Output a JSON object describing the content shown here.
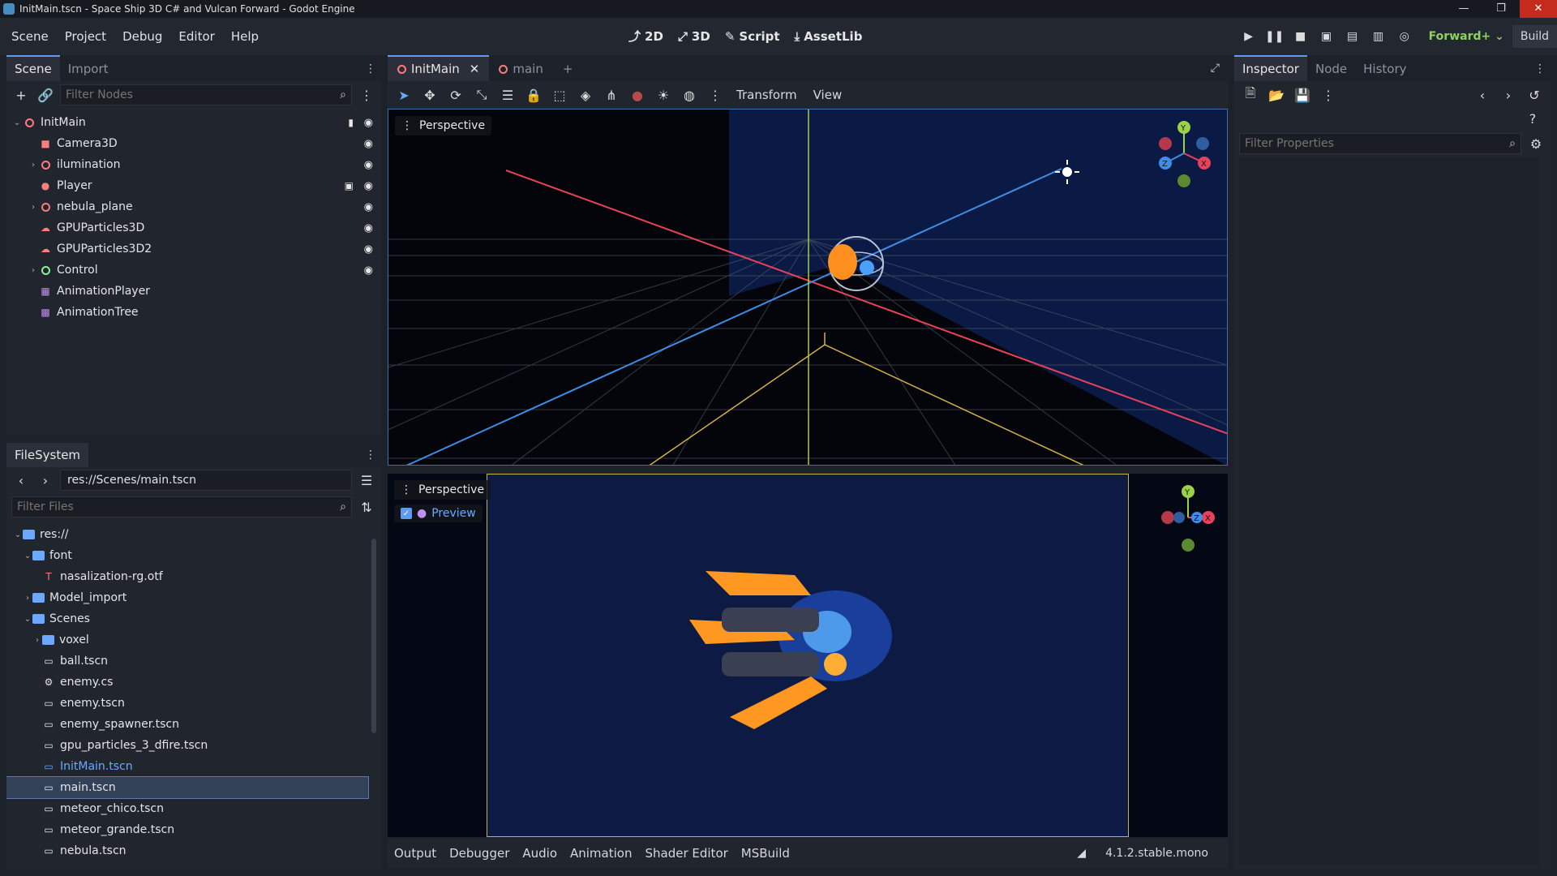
{
  "window": {
    "title": "InitMain.tscn - Space Ship 3D C# and Vulcan Forward - Godot Engine",
    "minimize": "—",
    "maximize": "❐",
    "close": "✕"
  },
  "menu": [
    "Scene",
    "Project",
    "Debug",
    "Editor",
    "Help"
  ],
  "modes": {
    "m2d": "2D",
    "m3d": "3D",
    "script": "Script",
    "assetlib": "AssetLib"
  },
  "run": {
    "renderer": "Forward+",
    "build": "Build"
  },
  "scene_dock": {
    "tabs": [
      "Scene",
      "Import"
    ],
    "filter_placeholder": "Filter Nodes",
    "nodes": [
      {
        "label": "InitMain",
        "color": "#ff7a7a"
      },
      {
        "label": "Camera3D",
        "color": "#fc7f7f"
      },
      {
        "label": "ilumination",
        "color": "#fc7f7f"
      },
      {
        "label": "Player",
        "color": "#fc7f7f"
      },
      {
        "label": "nebula_plane",
        "color": "#fc7f7f"
      },
      {
        "label": "GPUParticles3D",
        "color": "#fc7f7f"
      },
      {
        "label": "GPUParticles3D2",
        "color": "#fc7f7f"
      },
      {
        "label": "Control",
        "color": "#8eef97"
      },
      {
        "label": "AnimationPlayer",
        "color": "#c38ef1"
      },
      {
        "label": "AnimationTree",
        "color": "#c38ef1"
      }
    ]
  },
  "filesystem": {
    "tab": "FileSystem",
    "path": "res://Scenes/main.tscn",
    "filter_placeholder": "Filter Files",
    "items": [
      {
        "label": "res://",
        "type": "folder"
      },
      {
        "label": "font",
        "type": "folder"
      },
      {
        "label": "nasalization-rg.otf",
        "type": "font"
      },
      {
        "label": "Model_import",
        "type": "folder"
      },
      {
        "label": "Scenes",
        "type": "folder"
      },
      {
        "label": "voxel",
        "type": "folder"
      },
      {
        "label": "ball.tscn",
        "type": "scene"
      },
      {
        "label": "enemy.cs",
        "type": "script"
      },
      {
        "label": "enemy.tscn",
        "type": "scene"
      },
      {
        "label": "enemy_spawner.tscn",
        "type": "scene"
      },
      {
        "label": "gpu_particles_3_dfire.tscn",
        "type": "scene"
      },
      {
        "label": "InitMain.tscn",
        "type": "scene"
      },
      {
        "label": "main.tscn",
        "type": "scene"
      },
      {
        "label": "meteor_chico.tscn",
        "type": "scene"
      },
      {
        "label": "meteor_grande.tscn",
        "type": "scene"
      },
      {
        "label": "nebula.tscn",
        "type": "scene"
      }
    ]
  },
  "viewport": {
    "tabs": [
      "InitMain",
      "main"
    ],
    "add_tab": "+",
    "toolbar": {
      "transform": "Transform",
      "view": "View"
    },
    "top_label": "Perspective",
    "bottom_label": "Perspective",
    "preview": "Preview",
    "gizmo": {
      "x": "X",
      "y": "Y",
      "z": "Z"
    }
  },
  "bottom_panel": [
    "Output",
    "Debugger",
    "Audio",
    "Animation",
    "Shader Editor",
    "MSBuild"
  ],
  "version": "4.1.2.stable.mono",
  "inspector": {
    "tabs": [
      "Inspector",
      "Node",
      "History"
    ],
    "filter_placeholder": "Filter Properties"
  }
}
